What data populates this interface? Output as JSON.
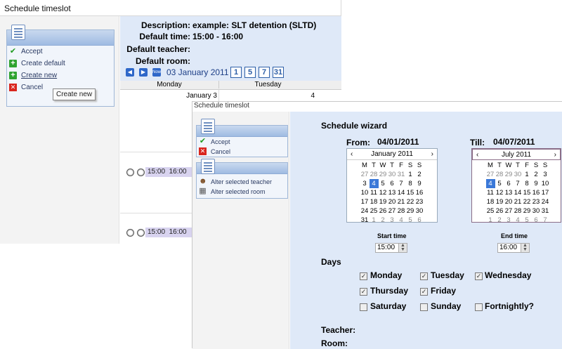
{
  "back": {
    "title": "Schedule timeslot",
    "menu": [
      {
        "label": "Accept",
        "icon": "check-icon"
      },
      {
        "label": "Create default",
        "icon": "plus-icon"
      },
      {
        "label": "Create new",
        "icon": "plus-icon"
      },
      {
        "label": "Cancel",
        "icon": "cancel-icon"
      }
    ],
    "tooltip": "Create new",
    "info": {
      "description_label": "Description:",
      "description_value": "example: SLT detention (SLTD)",
      "default_time_label": "Default time:",
      "default_time_value": "15:00 - 16:00",
      "default_teacher_label": "Default teacher:",
      "default_room_label": "Default room:"
    },
    "nav": {
      "now": "Now",
      "date": "03 January 2011",
      "views": [
        "1",
        "5",
        "7",
        "31"
      ]
    },
    "columns": [
      "Monday",
      "Tuesday"
    ],
    "dates": [
      "January 3",
      "4"
    ],
    "slots": [
      {
        "start": "15:00",
        "end": "16:00"
      },
      {
        "start": "15:00",
        "end": "16:00"
      }
    ]
  },
  "front": {
    "title": "Schedule timeslot",
    "menu1": [
      {
        "label": "Accept",
        "icon": "check-icon"
      },
      {
        "label": "Cancel",
        "icon": "cancel-icon"
      }
    ],
    "menu2": [
      {
        "label": "Alter selected teacher",
        "icon": "teacher-icon"
      },
      {
        "label": "Alter selected room",
        "icon": "room-icon"
      }
    ],
    "wizard_title": "Schedule wizard",
    "from_label": "From:",
    "from_value": "04/01/2011",
    "till_label": "Till:",
    "till_value": "04/07/2011",
    "weekdays": [
      "M",
      "T",
      "W",
      "T",
      "F",
      "S",
      "S"
    ],
    "cal_from": {
      "month": "January 2011",
      "days": [
        [
          "27",
          "28",
          "29",
          "30",
          "31",
          "1",
          "2"
        ],
        [
          "3",
          "4",
          "5",
          "6",
          "7",
          "8",
          "9"
        ],
        [
          "10",
          "11",
          "12",
          "13",
          "14",
          "15",
          "16"
        ],
        [
          "17",
          "18",
          "19",
          "20",
          "21",
          "22",
          "23"
        ],
        [
          "24",
          "25",
          "26",
          "27",
          "28",
          "29",
          "30"
        ],
        [
          "31",
          "1",
          "2",
          "3",
          "4",
          "5",
          "6"
        ]
      ],
      "selected": "4"
    },
    "cal_till": {
      "month": "July 2011",
      "days": [
        [
          "27",
          "28",
          "29",
          "30",
          "1",
          "2",
          "3"
        ],
        [
          "4",
          "5",
          "6",
          "7",
          "8",
          "9",
          "10"
        ],
        [
          "11",
          "12",
          "13",
          "14",
          "15",
          "16",
          "17"
        ],
        [
          "18",
          "19",
          "20",
          "21",
          "22",
          "23",
          "24"
        ],
        [
          "25",
          "26",
          "27",
          "28",
          "29",
          "30",
          "31"
        ],
        [
          "1",
          "2",
          "3",
          "4",
          "5",
          "6",
          "7"
        ]
      ],
      "selected": "4"
    },
    "start_time_label": "Start time",
    "start_time": "15:00",
    "end_time_label": "End time",
    "end_time": "16:00",
    "days_label": "Days",
    "days": [
      {
        "label": "Monday",
        "checked": true
      },
      {
        "label": "Tuesday",
        "checked": true
      },
      {
        "label": "Wednesday",
        "checked": true
      },
      {
        "label": "Thursday",
        "checked": true
      },
      {
        "label": "Friday",
        "checked": true
      },
      {
        "label": "Saturday",
        "checked": false
      },
      {
        "label": "Sunday",
        "checked": false
      },
      {
        "label": "Fortnightly?",
        "checked": false
      }
    ],
    "teacher_label": "Teacher:",
    "room_label": "Room:"
  }
}
